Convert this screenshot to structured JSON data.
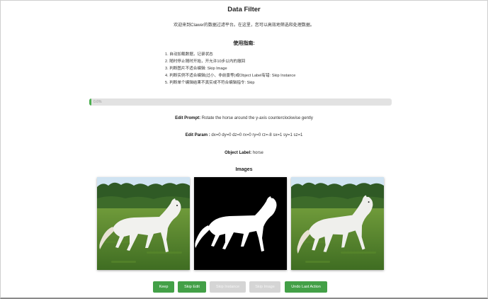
{
  "app": {
    "title": "Data Filter",
    "welcome": "欢迎来到Clawer的数据过滤平台。在这里，您可以高效地筛选和处理数据。"
  },
  "guide": {
    "title": "使用指南:",
    "items": [
      "1. 自动加载数据，记录状态",
      "2. 随时停止随时开始，开允许10步以内的撤回",
      "3. 判断图片不适合编辑: Skip Image",
      "4. 判断实例不适合编辑(过小、非前景等)或Object Label有错: Skip Instance",
      "5. 判断单个编辑结果不真实或不符合编辑指令: Skip"
    ]
  },
  "progress": {
    "fraction": 0.006,
    "text": "0.6%"
  },
  "edit_prompt": {
    "label": "Edit Prompt:",
    "value": "Rotate the horse around the y-axis counterclockwise gently"
  },
  "edit_param": {
    "label": "Edit Param :",
    "value": "dx=0 dy=0 dz=0 rx=0 ry=0 rz=-8 sx=1 sy=1 sz=1"
  },
  "object_label": {
    "label": "Object Label:",
    "value": "horse"
  },
  "images": {
    "title": "Images"
  },
  "buttons": {
    "keep": "Keep",
    "skip_edit": "Skip Edit",
    "skip_instance": "Skip Instance",
    "skip_image": "Skip Image",
    "undo": "Undo Last Action"
  },
  "colors": {
    "accent": "#43a047",
    "disabled": "#d5d5d5",
    "track": "#e2e2e2"
  }
}
